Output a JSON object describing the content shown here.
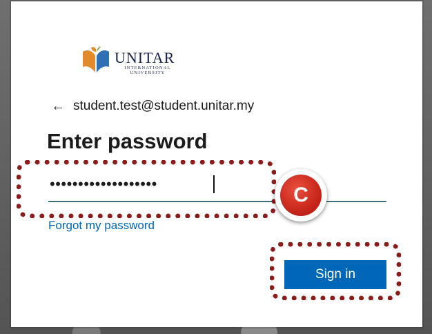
{
  "brand": {
    "name": "UNITAR",
    "subline1": "INTERNATIONAL",
    "subline2": "UNIVERSITY",
    "colors": {
      "orange": "#e38a2c",
      "blue": "#2f6fb4",
      "green": "#7aa84a",
      "navy": "#17234a"
    }
  },
  "identity": {
    "back_icon": "left-arrow-icon",
    "email": "student.test@student.unitar.my"
  },
  "page": {
    "title": "Enter password"
  },
  "password": {
    "masked_value": "•••••••••••••••••••"
  },
  "links": {
    "forgot": "Forgot my password"
  },
  "buttons": {
    "sign_in": "Sign in"
  },
  "annotation": {
    "step_label": "C",
    "highlight_color": "#8c1c1a",
    "badge_color": "#c8261b"
  },
  "colors": {
    "accent": "#0067b8",
    "underline": "#3b6e79"
  }
}
